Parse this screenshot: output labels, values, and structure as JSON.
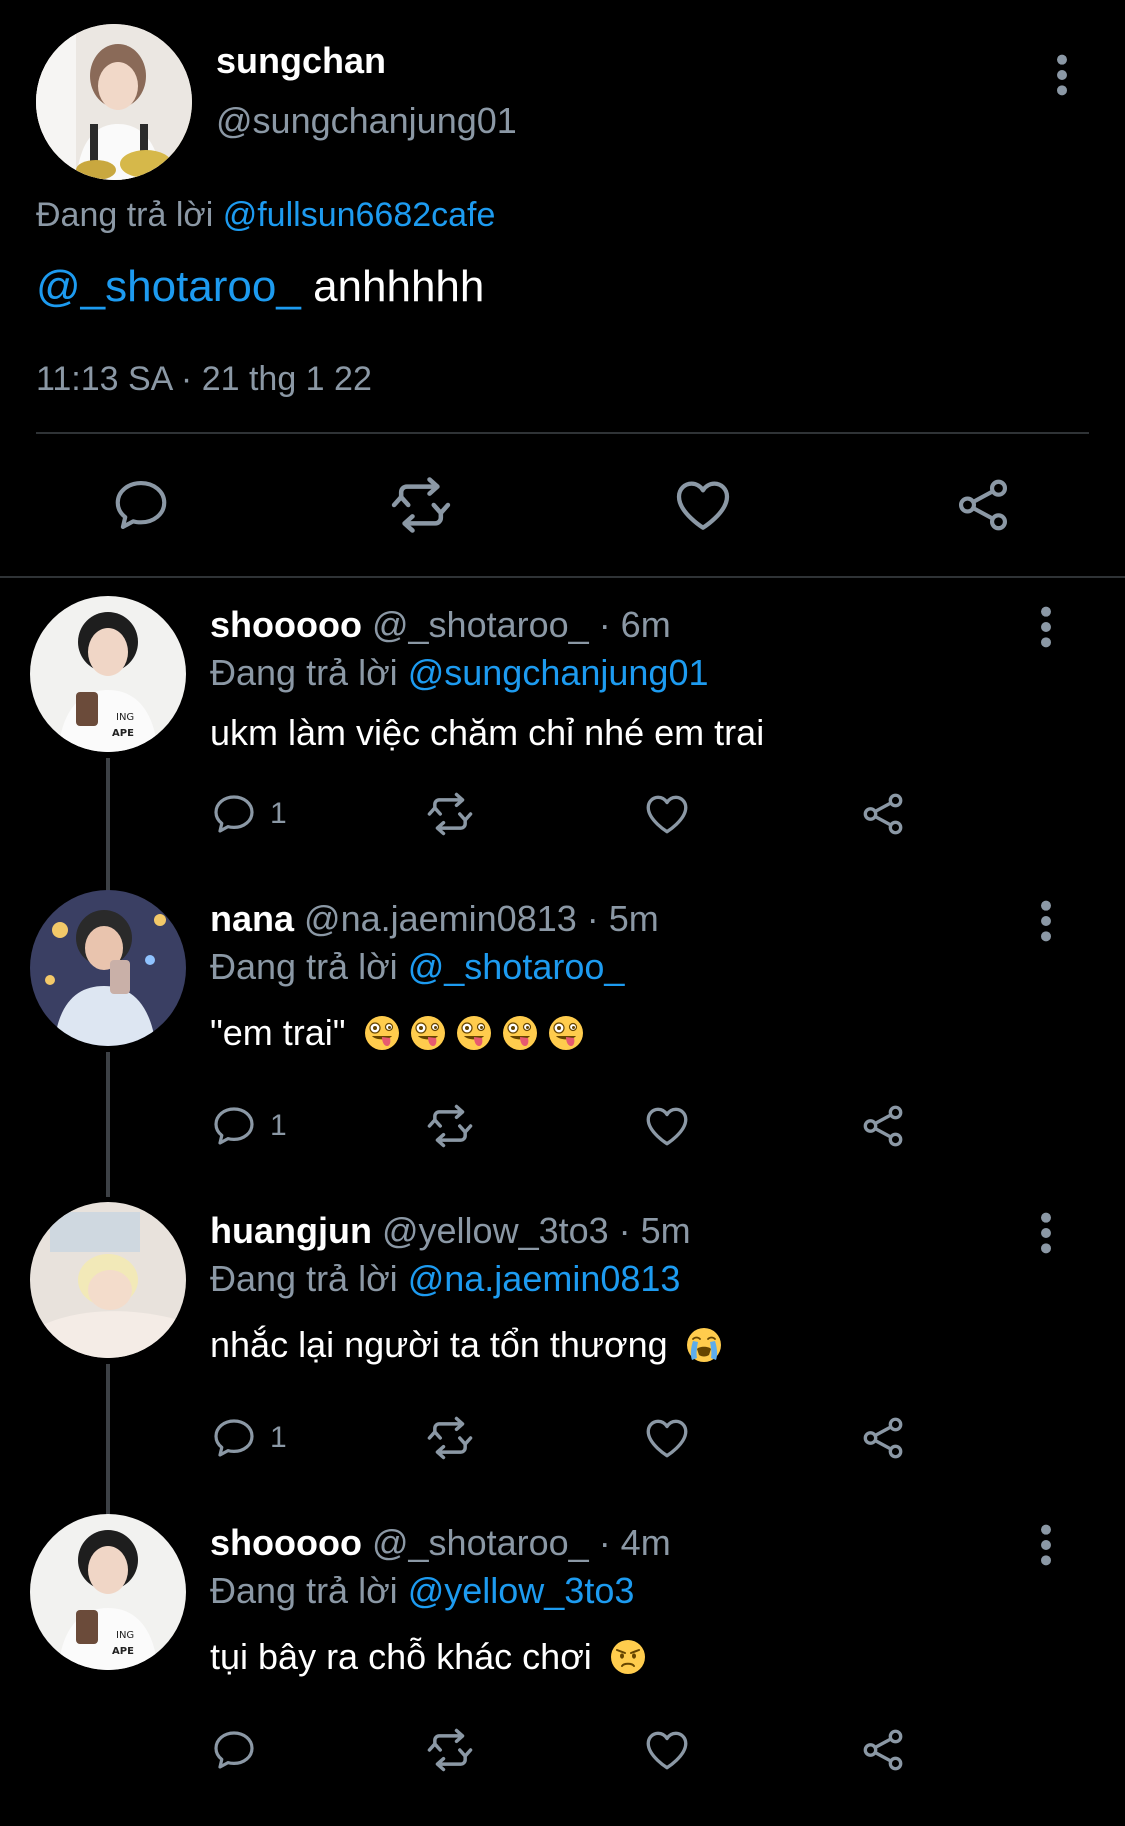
{
  "main_tweet": {
    "name": "sungchan",
    "handle": "@sungchanjung01",
    "reply_prefix": "Đang trả lời",
    "reply_to": "@fullsun6682cafe",
    "mention": "@_shotaroo_",
    "text": "anhhhhh",
    "timestamp": "11:13 SA · 21 thg 1 22"
  },
  "replies": [
    {
      "name": "shooooo",
      "handle": "@_shotaroo_",
      "time": "· 6m",
      "reply_prefix": "Đang trả lời",
      "reply_to": "@sungchanjung01",
      "text": "ukm làm việc chăm chỉ nhé em trai",
      "reply_count": "1",
      "emoji": []
    },
    {
      "name": "nana",
      "handle": "@na.jaemin0813",
      "time": "· 5m",
      "reply_prefix": "Đang trả lời",
      "reply_to": "@_shotaroo_",
      "text": "\"em trai\"",
      "reply_count": "1",
      "emoji": [
        "zany-face",
        "zany-face",
        "zany-face",
        "zany-face",
        "zany-face"
      ]
    },
    {
      "name": "huangjun",
      "handle": "@yellow_3to3",
      "time": "· 5m",
      "reply_prefix": "Đang trả lời",
      "reply_to": "@na.jaemin0813",
      "text": "nhắc lại người ta tổn thương",
      "reply_count": "1",
      "emoji": [
        "loudly-crying-face"
      ]
    },
    {
      "name": "shooooo",
      "handle": "@_shotaroo_",
      "time": "· 4m",
      "reply_prefix": "Đang trả lời",
      "reply_to": "@yellow_3to3",
      "text": "tụi bây ra chỗ khác chơi",
      "reply_count": "",
      "emoji": [
        "angry-face"
      ]
    }
  ],
  "icons": {
    "reply": "reply-icon",
    "retweet": "retweet-icon",
    "like": "heart-icon",
    "share": "share-icon",
    "more": "more-vertical-icon"
  },
  "colors": {
    "background": "#000000",
    "link": "#1d9bf0",
    "muted": "#8b98a5",
    "divider": "#2f3336"
  }
}
